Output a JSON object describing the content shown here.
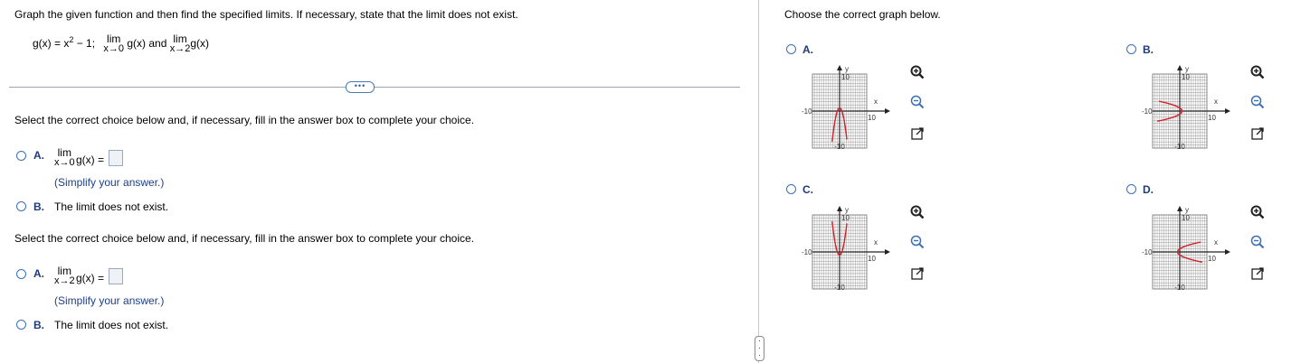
{
  "left": {
    "instruction": "Graph the given function and then find the specified limits. If necessary, state that the limit does not exist.",
    "function": {
      "prefix": "g(x) = x",
      "exp": "2",
      "suffix": " − 1;",
      "lim_word": "lim",
      "lim1_sub": "x→0",
      "mid": "g(x) and",
      "lim2_sub": "x→2",
      "end": "g(x)"
    },
    "expand_dots": "•••",
    "part1": {
      "prompt": "Select the correct choice below and, if necessary, fill in the answer box to complete your choice.",
      "optA_letter": "A.",
      "lim_word": "lim",
      "lim_sub": "x→0",
      "gx": "g(x) =",
      "hint": "(Simplify your answer.)",
      "optB_letter": "B.",
      "optB_text": "The limit does not exist."
    },
    "part2": {
      "prompt": "Select the correct choice below and, if necessary, fill in the answer box to complete your choice.",
      "optA_letter": "A.",
      "lim_word": "lim",
      "lim_sub": "x→2",
      "gx": "g(x) =",
      "hint": "(Simplify your answer.)",
      "optB_letter": "B.",
      "optB_text": "The limit does not exist."
    }
  },
  "right": {
    "prompt": "Choose the correct graph below.",
    "options": [
      {
        "letter": "A.",
        "curve": "parabola-down"
      },
      {
        "letter": "B.",
        "curve": "parabola-left"
      },
      {
        "letter": "C.",
        "curve": "parabola-up"
      },
      {
        "letter": "D.",
        "curve": "parabola-right"
      }
    ],
    "axis": {
      "xlabel": "x",
      "ylabel": "y",
      "tick_max": "10",
      "tick_min": "-10"
    }
  },
  "colors": {
    "curve": "#d0202a",
    "accent": "#3a6fb5",
    "grid": "#9a9a9a"
  },
  "icons": [
    "zoom-in-icon",
    "zoom-out-icon",
    "open-new-window-icon"
  ]
}
